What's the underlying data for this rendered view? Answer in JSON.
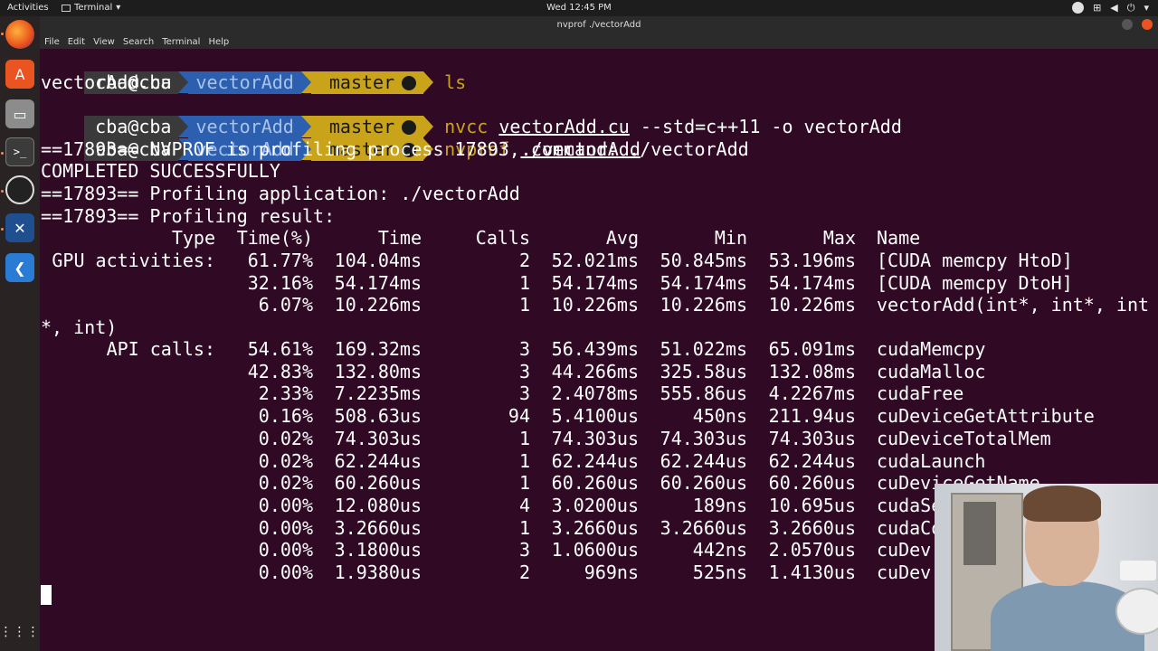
{
  "topbar": {
    "activities": "Activities",
    "app_menu": "Terminal",
    "app_menu_arrow": "▾",
    "clock": "Wed 12:45 PM",
    "tray_icons": [
      "ubuntu-software-icon",
      "network-icon",
      "volume-icon",
      "power-icon",
      "dropdown-icon"
    ]
  },
  "window": {
    "title": "nvprof ./vectorAdd",
    "menu": [
      "File",
      "Edit",
      "View",
      "Search",
      "Terminal",
      "Help"
    ]
  },
  "dock": {
    "apps": [
      "firefox-icon",
      "ubuntu-software-icon",
      "files-icon",
      "terminal-icon",
      "obs-icon",
      "x-app-icon",
      "vscode-icon"
    ],
    "show_apps": "show-applications-icon"
  },
  "prompt": {
    "user": "cba@cba",
    "dir": "vectorAdd",
    "branch_symbol": "",
    "branch": "master"
  },
  "lines": {
    "cmd1": "ls",
    "out1": "vectorAdd.cu",
    "cmd2_prog": "nvcc",
    "cmd2_file": "vectorAdd.cu",
    "cmd2_rest": "--std=c++11 -o vectorAdd",
    "cmd3_prog": "nvprof",
    "cmd3_file": "./vectorAdd",
    "p1": "==17893== NVPROF is profiling process 17893, command: ./vectorAdd",
    "p2": "COMPLETED SUCCESSFULLY",
    "p3": "==17893== Profiling application: ./vectorAdd",
    "p4": "==17893== Profiling result:"
  },
  "table": {
    "headers": {
      "type": "Type",
      "pct": "Time(%)",
      "time": "Time",
      "calls": "Calls",
      "avg": "Avg",
      "min": "Min",
      "max": "Max",
      "name": "Name"
    },
    "gpu_label": "GPU activities:",
    "api_label": "API calls:",
    "wrap": "*, int)",
    "gpu_rows": [
      {
        "pct": "61.77%",
        "time": "104.04ms",
        "calls": "2",
        "avg": "52.021ms",
        "min": "50.845ms",
        "max": "53.196ms",
        "name": "[CUDA memcpy HtoD]"
      },
      {
        "pct": "32.16%",
        "time": "54.174ms",
        "calls": "1",
        "avg": "54.174ms",
        "min": "54.174ms",
        "max": "54.174ms",
        "name": "[CUDA memcpy DtoH]"
      },
      {
        "pct": "6.07%",
        "time": "10.226ms",
        "calls": "1",
        "avg": "10.226ms",
        "min": "10.226ms",
        "max": "10.226ms",
        "name": "vectorAdd(int*, int*, int"
      }
    ],
    "api_rows": [
      {
        "pct": "54.61%",
        "time": "169.32ms",
        "calls": "3",
        "avg": "56.439ms",
        "min": "51.022ms",
        "max": "65.091ms",
        "name": "cudaMemcpy"
      },
      {
        "pct": "42.83%",
        "time": "132.80ms",
        "calls": "3",
        "avg": "44.266ms",
        "min": "325.58us",
        "max": "132.08ms",
        "name": "cudaMalloc"
      },
      {
        "pct": "2.33%",
        "time": "7.2235ms",
        "calls": "3",
        "avg": "2.4078ms",
        "min": "555.86us",
        "max": "4.2267ms",
        "name": "cudaFree"
      },
      {
        "pct": "0.16%",
        "time": "508.63us",
        "calls": "94",
        "avg": "5.4100us",
        "min": "450ns",
        "max": "211.94us",
        "name": "cuDeviceGetAttribute"
      },
      {
        "pct": "0.02%",
        "time": "74.303us",
        "calls": "1",
        "avg": "74.303us",
        "min": "74.303us",
        "max": "74.303us",
        "name": "cuDeviceTotalMem"
      },
      {
        "pct": "0.02%",
        "time": "62.244us",
        "calls": "1",
        "avg": "62.244us",
        "min": "62.244us",
        "max": "62.244us",
        "name": "cudaLaunch"
      },
      {
        "pct": "0.02%",
        "time": "60.260us",
        "calls": "1",
        "avg": "60.260us",
        "min": "60.260us",
        "max": "60.260us",
        "name": "cuDeviceGetName"
      },
      {
        "pct": "0.00%",
        "time": "12.080us",
        "calls": "4",
        "avg": "3.0200us",
        "min": "189ns",
        "max": "10.695us",
        "name": "cudaSe"
      },
      {
        "pct": "0.00%",
        "time": "3.2660us",
        "calls": "1",
        "avg": "3.2660us",
        "min": "3.2660us",
        "max": "3.2660us",
        "name": "cudaCo"
      },
      {
        "pct": "0.00%",
        "time": "3.1800us",
        "calls": "3",
        "avg": "1.0600us",
        "min": "442ns",
        "max": "2.0570us",
        "name": "cuDev"
      },
      {
        "pct": "0.00%",
        "time": "1.9380us",
        "calls": "2",
        "avg": "969ns",
        "min": "525ns",
        "max": "1.4130us",
        "name": "cuDev"
      }
    ]
  }
}
